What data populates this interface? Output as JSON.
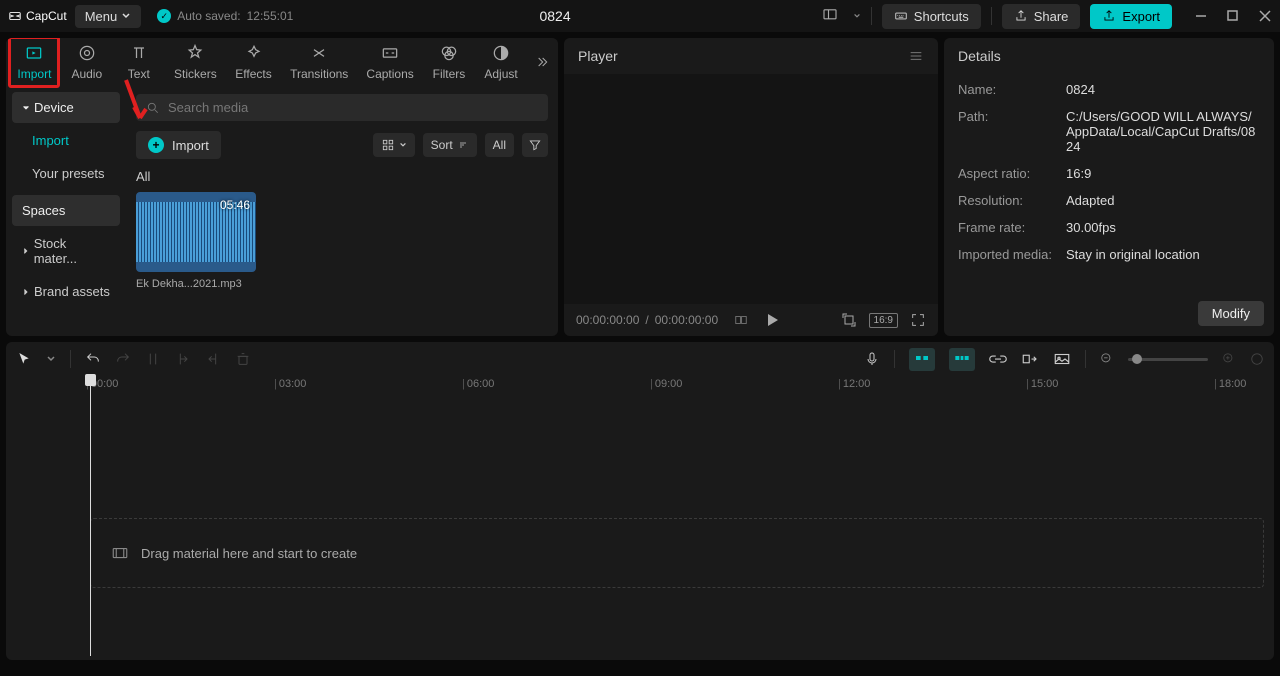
{
  "app": {
    "name": "CapCut"
  },
  "titlebar": {
    "menu": "Menu",
    "autosave_label": "Auto saved:",
    "autosave_time": "12:55:01",
    "project": "0824",
    "shortcuts": "Shortcuts",
    "share": "Share",
    "export": "Export"
  },
  "tooltabs": [
    {
      "id": "import",
      "label": "Import"
    },
    {
      "id": "audio",
      "label": "Audio"
    },
    {
      "id": "text",
      "label": "Text"
    },
    {
      "id": "stickers",
      "label": "Stickers"
    },
    {
      "id": "effects",
      "label": "Effects"
    },
    {
      "id": "transitions",
      "label": "Transitions"
    },
    {
      "id": "captions",
      "label": "Captions"
    },
    {
      "id": "filters",
      "label": "Filters"
    },
    {
      "id": "adjust",
      "label": "Adjust"
    }
  ],
  "sidebar": {
    "device": "Device",
    "import": "Import",
    "presets": "Your presets",
    "spaces": "Spaces",
    "stock": "Stock mater...",
    "brand": "Brand assets"
  },
  "media": {
    "search_placeholder": "Search media",
    "import": "Import",
    "sort": "Sort",
    "all": "All",
    "filter_all": "All",
    "thumb": {
      "duration": "05:46",
      "name": "Ek Dekha...2021.mp3"
    }
  },
  "player": {
    "title": "Player",
    "time_current": "00:00:00:00",
    "time_total": "00:00:00:00",
    "ratio_badge": "16:9"
  },
  "details": {
    "title": "Details",
    "rows": {
      "name_label": "Name:",
      "name_value": "0824",
      "path_label": "Path:",
      "path_value": "C:/Users/GOOD WILL ALWAYS/AppData/Local/CapCut Drafts/0824",
      "aspect_label": "Aspect ratio:",
      "aspect_value": "16:9",
      "res_label": "Resolution:",
      "res_value": "Adapted",
      "fps_label": "Frame rate:",
      "fps_value": "30.00fps",
      "imported_label": "Imported media:",
      "imported_value": "Stay in original location"
    },
    "modify": "Modify"
  },
  "timeline": {
    "ruler": [
      "00:00",
      "03:00",
      "06:00",
      "09:00",
      "12:00",
      "15:00",
      "18:00"
    ],
    "drop_hint": "Drag material here and start to create"
  }
}
